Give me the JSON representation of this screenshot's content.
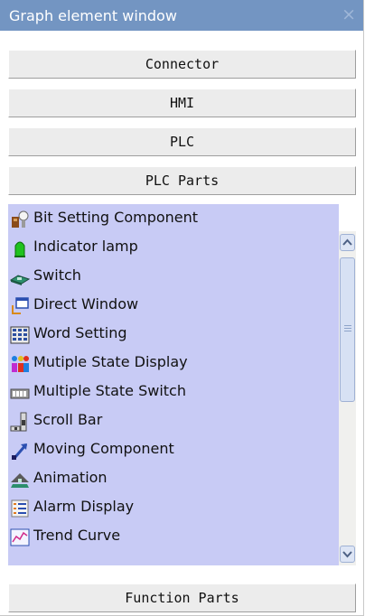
{
  "window": {
    "title": "Graph element window",
    "close_glyph": "×"
  },
  "sections": {
    "connector": "Connector",
    "hmi": "HMI",
    "plc": "PLC",
    "plc_parts": "PLC Parts",
    "function_parts": "Function Parts"
  },
  "plc_parts_items": [
    {
      "label": "Bit Setting Component",
      "icon": "bit-setting-icon"
    },
    {
      "label": "Indicator lamp",
      "icon": "indicator-lamp-icon"
    },
    {
      "label": "Switch",
      "icon": "switch-icon"
    },
    {
      "label": "Direct Window",
      "icon": "direct-window-icon"
    },
    {
      "label": "Word Setting",
      "icon": "word-setting-icon"
    },
    {
      "label": "Mutiple State Display",
      "icon": "multiple-state-display-icon"
    },
    {
      "label": "Multiple State Switch",
      "icon": "multiple-state-switch-icon"
    },
    {
      "label": "Scroll Bar",
      "icon": "scroll-bar-icon"
    },
    {
      "label": "Moving Component",
      "icon": "moving-component-icon"
    },
    {
      "label": "Animation",
      "icon": "animation-icon"
    },
    {
      "label": "Alarm Display",
      "icon": "alarm-display-icon"
    },
    {
      "label": "Trend Curve",
      "icon": "trend-curve-icon"
    }
  ],
  "colors": {
    "titlebar": "#7395c2",
    "list_background": "#c8cbf5",
    "section_button": "#ececec"
  }
}
